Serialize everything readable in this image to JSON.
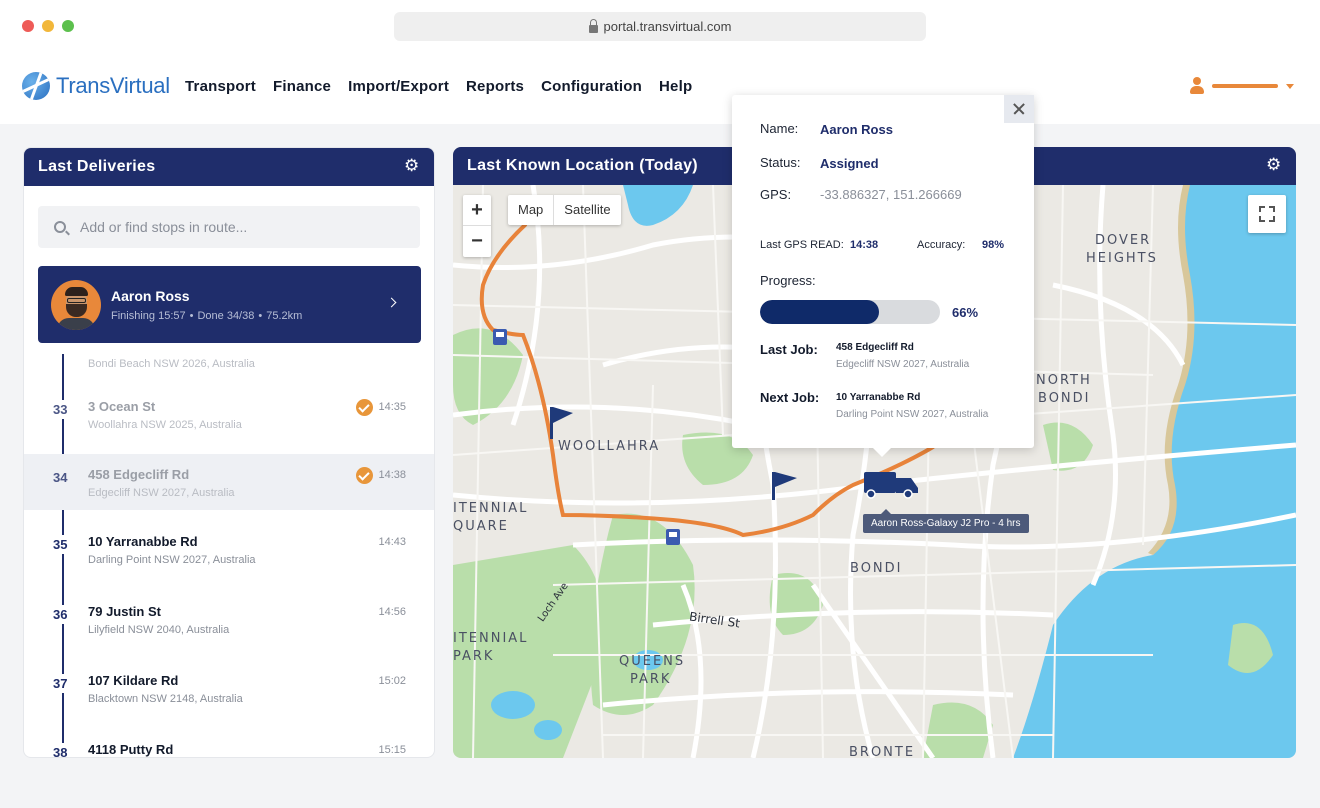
{
  "browser": {
    "url": "portal.transvirtual.com"
  },
  "app": {
    "logo_text": "TransVirtual"
  },
  "nav": [
    "Transport",
    "Finance",
    "Import/Export",
    "Reports",
    "Configuration",
    "Help"
  ],
  "left_panel": {
    "title": "Last Deliveries",
    "search_placeholder": "Add or find stops in route...",
    "driver": {
      "name": "Aaron Ross",
      "finishing": "Finishing 15:57",
      "done": "Done 34/38",
      "distance": "75.2km"
    },
    "faded_address": "Bondi Beach NSW 2026, Australia",
    "stops": [
      {
        "num": "33",
        "title": "3 Ocean St",
        "sub": "Woollahra NSW 2025, Australia",
        "time": "14:35",
        "done": true
      },
      {
        "num": "34",
        "title": "458 Edgecliff Rd",
        "sub": "Edgecliff NSW 2027, Australia",
        "time": "14:38",
        "done": true
      },
      {
        "num": "35",
        "title": "10 Yarranabbe Rd",
        "sub": "Darling Point NSW 2027, Australia",
        "time": "14:43",
        "done": false
      },
      {
        "num": "36",
        "title": "79 Justin St",
        "sub": "Lilyfield NSW 2040, Australia",
        "time": "14:56",
        "done": false
      },
      {
        "num": "37",
        "title": "107 Kildare Rd",
        "sub": "Blacktown NSW 2148, Australia",
        "time": "15:02",
        "done": false
      },
      {
        "num": "38",
        "title": "4118 Putty Rd",
        "sub": "",
        "time": "15:15",
        "done": false
      }
    ]
  },
  "map_panel": {
    "title": "Last Known Location (Today)",
    "map_types": [
      "Map",
      "Satellite"
    ],
    "zoom_in": "+",
    "zoom_out": "−",
    "places": {
      "woollahra": "WOOLLAHRA",
      "dover1": "DOVER",
      "dover2": "HEIGHTS",
      "north1": "NORTH",
      "north2": "BONDI",
      "bondi": "BONDI",
      "centennial1": "ITENNIAL",
      "centennial2": "QUARE",
      "centennial3": "ITENNIAL",
      "centennial4": "PARK",
      "queens1": "QUEENS",
      "queens2": "PARK",
      "bronte": "BRONTE"
    },
    "streets": {
      "birrell": "Birrell St",
      "loch": "Loch Ave"
    },
    "truck_tooltip": "Aaron Ross-Galaxy J2 Pro - 4 hrs",
    "colors": {
      "route": "#e8833a",
      "water": "#6cc8ee",
      "park": "#b9deaa",
      "marker": "#1f3a7a"
    }
  },
  "popup": {
    "name_label": "Name:",
    "name_value": "Aaron Ross",
    "status_label": "Status:",
    "status_value": "Assigned",
    "gps_label": "GPS:",
    "gps_value": "-33.886327, 151.266669",
    "last_gps_label": "Last GPS READ:",
    "last_gps_value": "14:38",
    "accuracy_label": "Accuracy:",
    "accuracy_value": "98%",
    "progress_label": "Progress:",
    "progress_value": "66%",
    "progress_fraction": 0.66,
    "last_job_label": "Last Job:",
    "last_job_title": "458 Edgecliff Rd",
    "last_job_sub": "Edgecliff NSW 2027, Australia",
    "next_job_label": "Next Job:",
    "next_job_title": "10 Yarranabbe Rd",
    "next_job_sub": "Darling Point NSW 2027, Australia"
  }
}
